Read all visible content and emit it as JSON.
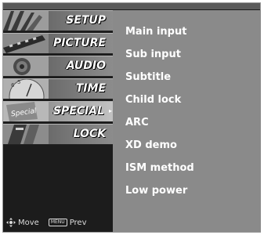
{
  "menu": {
    "tabs": [
      {
        "label": "SETUP",
        "icon": "setup-icon",
        "active": false
      },
      {
        "label": "PICTURE",
        "icon": "picture-icon",
        "active": false
      },
      {
        "label": "AUDIO",
        "icon": "audio-icon",
        "active": false
      },
      {
        "label": "TIME",
        "icon": "time-icon",
        "active": false
      },
      {
        "label": "SPECIAL",
        "icon": "special-icon",
        "active": true,
        "arrow": "▸"
      },
      {
        "label": "LOCK",
        "icon": "lock-icon",
        "active": false
      }
    ],
    "special_thumb_text": "Special"
  },
  "submenu": {
    "items": [
      "Main input",
      "Sub input",
      "Subtitle",
      "Child lock",
      "ARC",
      "XD demo",
      "ISM method",
      "Low power"
    ]
  },
  "footer": {
    "move_label": "Move",
    "menu_key": "MENU",
    "prev_label": "Prev"
  },
  "colors": {
    "frame": "#1c1c1c",
    "submenu_bg": "#8a8a8a",
    "text": "#ffffff"
  }
}
